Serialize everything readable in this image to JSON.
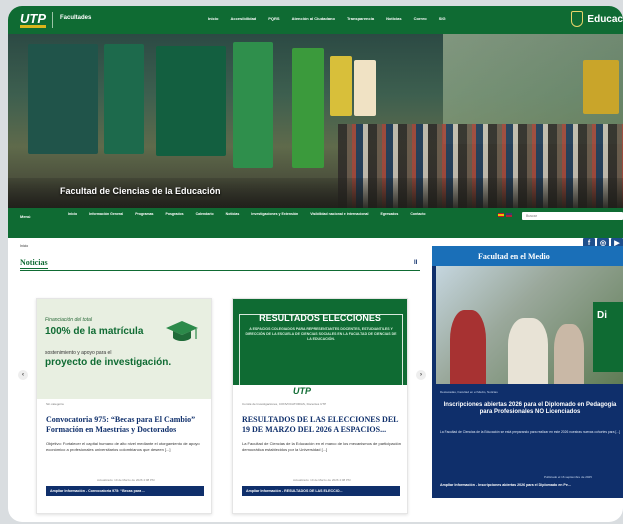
{
  "header": {
    "site_title": "Facultades",
    "logo_text": "UTP",
    "nav": [
      "Inicio",
      "Accesibilidad",
      "PQRS",
      "Atención al Ciudadano",
      "Transparencia",
      "Noticias",
      "Correo",
      "SIG"
    ],
    "gov_label": "Educac"
  },
  "hero": {
    "title": "Facultad de Ciencias de la Educación"
  },
  "main_nav": {
    "home": "Menú",
    "items": [
      "Inicio",
      "Información General",
      "Programas",
      "Posgrados",
      "Calendario",
      "Noticias",
      "Investigaciones y Extensión",
      "Visibilidad nacional e internacional",
      "Egresados",
      "Contacto"
    ],
    "search_placeholder": "Buscar"
  },
  "breadcrumb": "Inicio",
  "social": {
    "facebook": "f",
    "instagram": "◎",
    "youtube": "▶"
  },
  "news": {
    "heading": "Noticias",
    "pause": "II",
    "prev": "‹",
    "next": "›",
    "cards": [
      {
        "img_tag": "Financiación del total",
        "img_big": "100% de la matrícula",
        "img_mid": "sostenimiento y apoyo para el",
        "img_big2": "proyecto de investigación.",
        "meta": "Sin categoría",
        "title": "Convocatoria 975: “Becas para El Cambio” Formación en Maestrías y Doctorados",
        "body": "Objetivo: Fortalecer el capital humano de alto nivel mediante el otorgamiento de apoyo económico a profesionales universitarios colombianos que deseen [...]",
        "date": "Actualizado: 19 de Marzo de 2026 4:08 PM",
        "more": "Ampliar Información - Convocatoria 975: “Becas para ..."
      },
      {
        "img_title": "RESULTADOS ELECCIONES",
        "img_sub": "A ESPACIOS COLEGIADOS PARA REPRESENTANTES DOCENTES, ESTUDIANTILES Y DIRECCIÓN DE LA ESCUELA DE CIENCIAS SOCIALES EN LA FACULTAD DE CIENCIAS DE LA EDUCACIÓN.",
        "img_logo": "UTP",
        "meta": "Comité de Investigaciones, CONVOCATORIAS, Docentes UTP",
        "title": "RESULTADOS DE LAS ELECCIONES DEL 19 DE MARZO DEL 2026 A ESPACIOS...",
        "body": "La Facultad de Ciencias de la Educación en el marco de los mecanismos de participación democrática establecidos por la Universidad [...]",
        "date": "Actualizado: 19 de Marzo de 2026 4:08 PM",
        "more": "Ampliar Información - RESULTADOS DE LAS ELECCIO..."
      }
    ]
  },
  "sidebar": {
    "heading": "Facultad en el Medio",
    "photo_text": "Di",
    "tags": "Destacadas, Facultad en el Medio, Noticias",
    "title": "Inscripciones abiertas 2026 para el Diplomado en Pedagogía para Profesionales NO Licenciados",
    "body": "La Facultad de Ciencias de la Educación se está preparando para realizar en este 2026 nuestras nuevas cohortes para [...]",
    "date": "Publicado el 16 septiembre de 2025",
    "more": "Ampliar Información - Inscripciones abiertas 2026 para el Diplomado en Pe..."
  }
}
